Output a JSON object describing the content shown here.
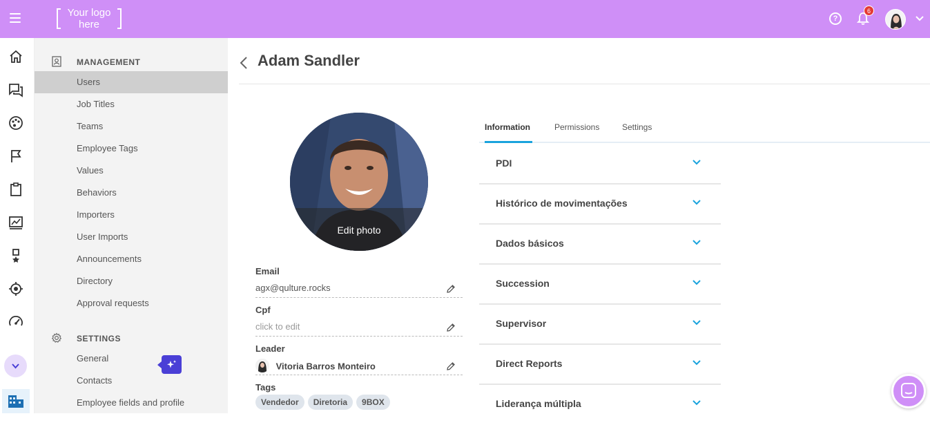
{
  "header": {
    "logo_line1": "Your logo",
    "logo_line2": "here",
    "notification_count": "6",
    "brand_color": "#cf8ff7"
  },
  "rail": {
    "icons": [
      "home-icon",
      "chat-icon",
      "palette-icon",
      "flag-icon",
      "clipboard-icon",
      "chart-icon",
      "medal-icon",
      "target-icon",
      "speedometer-icon",
      "more-icon",
      "building-icon"
    ]
  },
  "sidebar": {
    "management_label": "MANAGEMENT",
    "management_items": [
      {
        "label": "Users"
      },
      {
        "label": "Job Titles"
      },
      {
        "label": "Teams"
      },
      {
        "label": "Employee Tags"
      },
      {
        "label": "Values"
      },
      {
        "label": "Behaviors"
      },
      {
        "label": "Importers"
      },
      {
        "label": "User Imports"
      },
      {
        "label": "Announcements"
      },
      {
        "label": "Directory"
      },
      {
        "label": "Approval requests"
      }
    ],
    "settings_label": "SETTINGS",
    "settings_items": [
      {
        "label": "General"
      },
      {
        "label": "Contacts"
      },
      {
        "label": "Employee fields and profile"
      }
    ]
  },
  "profile": {
    "name": "Adam Sandler",
    "edit_photo_label": "Edit photo",
    "email_label": "Email",
    "email_value": "agx@qulture.rocks",
    "cpf_label": "Cpf",
    "cpf_placeholder": "click to edit",
    "leader_label": "Leader",
    "leader_value": "Vitoria Barros Monteiro",
    "tags_label": "Tags",
    "tags": [
      "Vendedor",
      "Diretoria",
      "9BOX"
    ]
  },
  "tabs": [
    {
      "label": "Information"
    },
    {
      "label": "Permissions"
    },
    {
      "label": "Settings"
    }
  ],
  "sections": [
    {
      "label": "PDI"
    },
    {
      "label": "Histórico de movimentações"
    },
    {
      "label": "Dados básicos"
    },
    {
      "label": "Succession"
    },
    {
      "label": "Supervisor"
    },
    {
      "label": "Direct Reports"
    },
    {
      "label": "Liderança múltipla"
    }
  ]
}
